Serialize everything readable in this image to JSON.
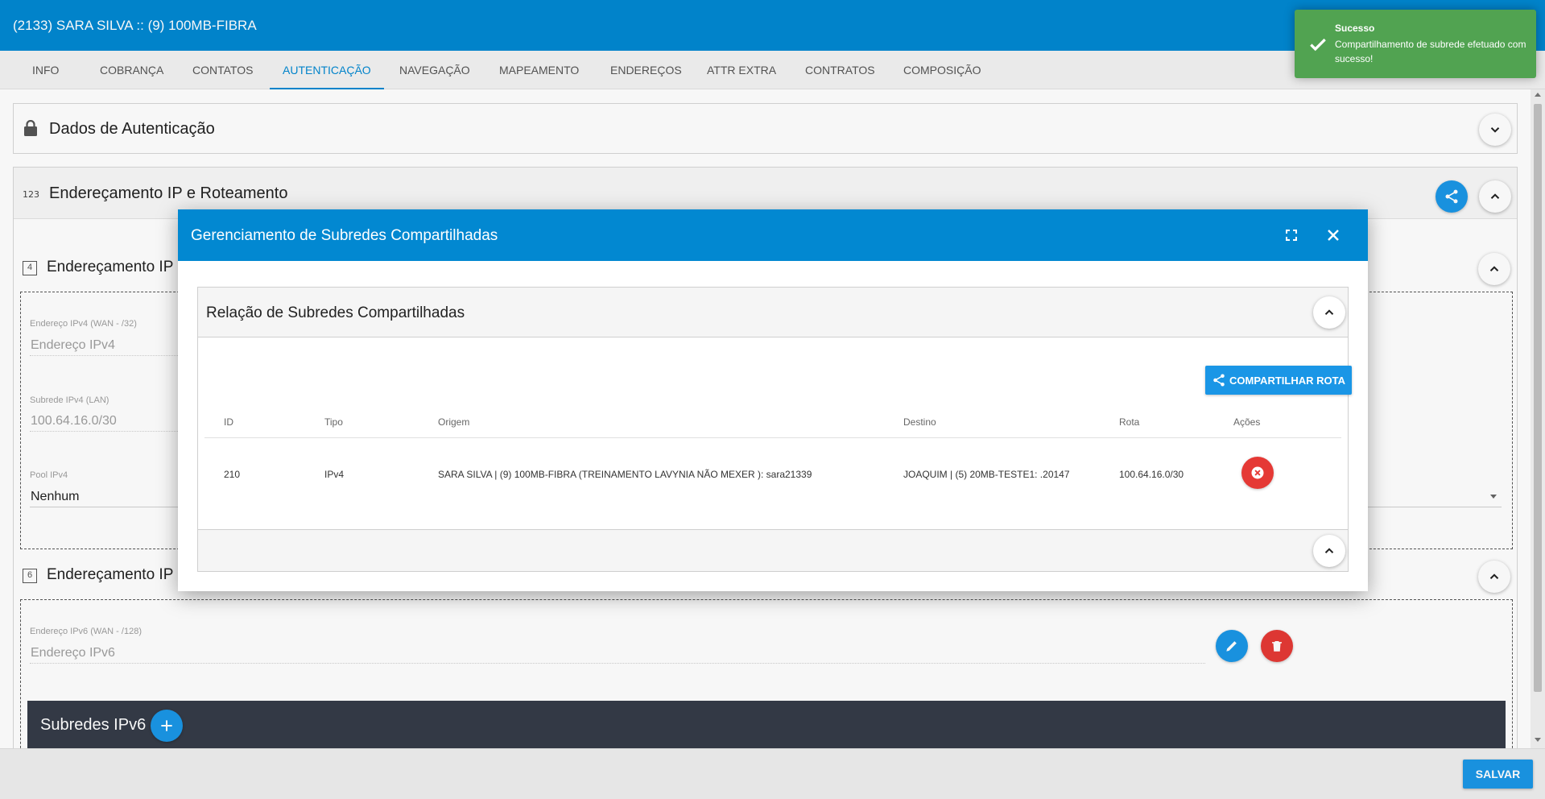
{
  "header": {
    "title": "(2133) SARA SILVA :: (9) 100MB-FIBRA"
  },
  "tabs": [
    {
      "label": "INFO"
    },
    {
      "label": "COBRANÇA"
    },
    {
      "label": "CONTATOS"
    },
    {
      "label": "AUTENTICAÇÃO",
      "active": true
    },
    {
      "label": "NAVEGAÇÃO"
    },
    {
      "label": "MAPEAMENTO"
    },
    {
      "label": "ENDEREÇOS"
    },
    {
      "label": "ATTR EXTRA"
    },
    {
      "label": "CONTRATOS"
    },
    {
      "label": "COMPOSIÇÃO"
    }
  ],
  "panels": {
    "auth": {
      "title": "Dados de Autenticação"
    },
    "ip": {
      "title": "Endereçamento IP e Roteamento"
    }
  },
  "ipv4": {
    "section_title": "Endereçamento IP",
    "section_icon": "4",
    "wan_label": "Endereço IPv4 (WAN - /32)",
    "wan_placeholder": "Endereço IPv4",
    "lan_label": "Subrede IPv4 (LAN)",
    "lan_value": "100.64.16.0/30",
    "pool_label": "Pool IPv4",
    "pool_value": "Nenhum"
  },
  "ipv6": {
    "section_title": "Endereçamento IP",
    "section_icon": "6",
    "wan_label": "Endereço IPv6 (WAN - /128)",
    "wan_placeholder": "Endereço IPv6",
    "subnets_label": "Subredes IPv6"
  },
  "modal": {
    "title": "Gerenciamento de Subredes Compartilhadas",
    "panel_title": "Relação de Subredes Compartilhadas",
    "share_button": "COMPARTILHAR ROTA",
    "columns": [
      "ID",
      "Tipo",
      "Origem",
      "Destino",
      "Rota",
      "Ações"
    ],
    "rows": [
      {
        "id": "210",
        "tipo": "IPv4",
        "origem": "SARA SILVA | (9) 100MB-FIBRA (TREINAMENTO LAVYNIA NÃO MEXER ): sara21339",
        "destino": "JOAQUIM | (5) 20MB-TESTE1: .20147",
        "rota": "100.64.16.0/30"
      }
    ]
  },
  "toast": {
    "title": "Sucesso",
    "message": "Compartilhamento de subrede efetuado com sucesso!"
  },
  "footer": {
    "save_label": "SALVAR"
  },
  "colors": {
    "primary": "#0288d1",
    "button_blue": "#1a96e6",
    "danger": "#e53935",
    "success": "#51a351",
    "dark_bar": "#353b48"
  },
  "icons": [
    "lock-icon",
    "numeric-123-icon",
    "share-icon",
    "chevron-up-icon",
    "chevron-down-icon",
    "fullscreen-icon",
    "close-icon",
    "pencil-icon",
    "trash-icon",
    "plus-icon",
    "check-icon",
    "close-circle-icon"
  ]
}
